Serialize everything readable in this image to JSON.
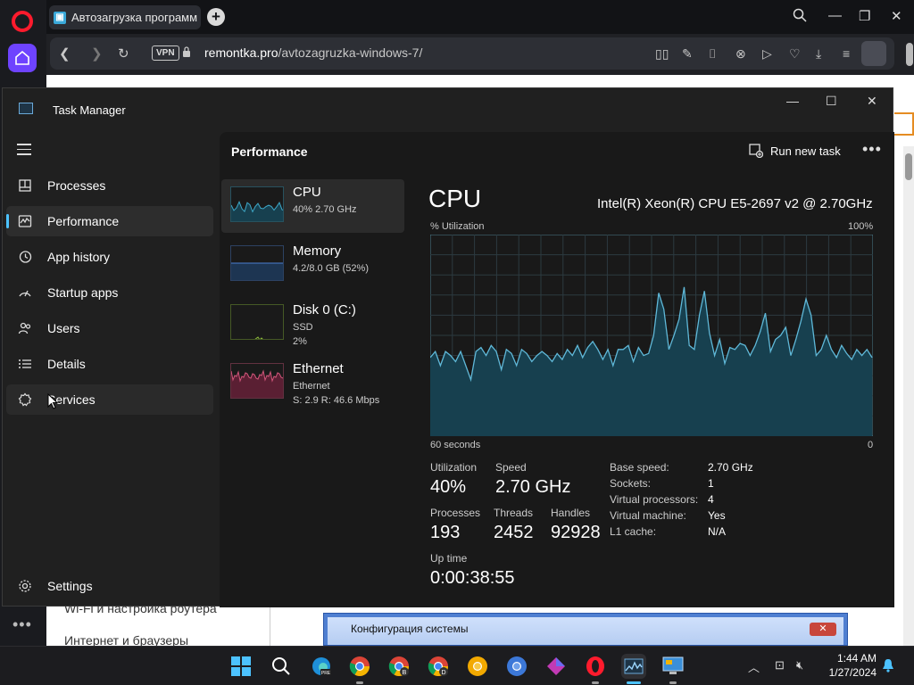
{
  "browser": {
    "tab_title": "Автозагрузка программ в",
    "tab_favicon": "monitor-icon",
    "vpn_label": "VPN",
    "url_domain": "remontka.pro",
    "url_path": "/avtozagruzka-windows-7/"
  },
  "webpage": {
    "menu_item_1": "Wi-Fi и настройка роутера",
    "menu_item_2": "Интернет и браузеры",
    "dialog_title": "Конфигурация системы"
  },
  "taskmanager": {
    "title": "Task Manager",
    "nav": [
      {
        "label": "Processes",
        "icon": "processes-icon"
      },
      {
        "label": "Performance",
        "icon": "performance-icon"
      },
      {
        "label": "App history",
        "icon": "history-icon"
      },
      {
        "label": "Startup apps",
        "icon": "startup-icon"
      },
      {
        "label": "Users",
        "icon": "users-icon"
      },
      {
        "label": "Details",
        "icon": "details-icon"
      },
      {
        "label": "Services",
        "icon": "services-icon"
      }
    ],
    "settings_label": "Settings",
    "active_nav": "Performance",
    "performance": {
      "heading": "Performance",
      "run_new_task": "Run new task",
      "resources": [
        {
          "name": "CPU",
          "sub1": "40%  2.70 GHz",
          "sub2": "",
          "color": "#3ea8c8"
        },
        {
          "name": "Memory",
          "sub1": "4.2/8.0 GB (52%)",
          "sub2": "",
          "color": "#4a7fd0"
        },
        {
          "name": "Disk 0 (C:)",
          "sub1": "SSD",
          "sub2": "2%",
          "color": "#8ab83a"
        },
        {
          "name": "Ethernet",
          "sub1": "Ethernet",
          "sub2": "S: 2.9  R: 46.6 Mbps",
          "color": "#d0567a"
        }
      ],
      "cpu": {
        "title": "CPU",
        "model": "Intel(R) Xeon(R) CPU E5-2697 v2 @ 2.70GHz",
        "y_label": "% Utilization",
        "y_max_label": "100%",
        "x_left_label": "60 seconds",
        "x_right_label": "0",
        "utilization_label": "Utilization",
        "utilization": "40%",
        "speed_label": "Speed",
        "speed": "2.70 GHz",
        "processes_label": "Processes",
        "processes": "193",
        "threads_label": "Threads",
        "threads": "2452",
        "handles_label": "Handles",
        "handles": "92928",
        "uptime_label": "Up time",
        "uptime": "0:00:38:55",
        "specs": [
          {
            "label": "Base speed:",
            "value": "2.70 GHz"
          },
          {
            "label": "Sockets:",
            "value": "1"
          },
          {
            "label": "Virtual processors:",
            "value": "4"
          },
          {
            "label": "Virtual machine:",
            "value": "Yes"
          },
          {
            "label": "L1 cache:",
            "value": "N/A"
          }
        ]
      }
    }
  },
  "chart_data": {
    "type": "area",
    "y_label": "% Utilization",
    "ylim": [
      0,
      100
    ],
    "x_labels": [
      "60 seconds",
      "0"
    ],
    "values": [
      39,
      42,
      35,
      42,
      40,
      37,
      42,
      35,
      28,
      42,
      44,
      40,
      45,
      42,
      33,
      43,
      41,
      35,
      43,
      41,
      37,
      40,
      42,
      40,
      37,
      41,
      38,
      43,
      40,
      45,
      39,
      44,
      47,
      43,
      38,
      43,
      35,
      43,
      43,
      45,
      37,
      44,
      40,
      41,
      50,
      71,
      63,
      43,
      50,
      58,
      74,
      45,
      43,
      60,
      72,
      51,
      40,
      48,
      36,
      44,
      43,
      46,
      45,
      40,
      45,
      52,
      61,
      42,
      48,
      50,
      54,
      40,
      48,
      57,
      68,
      60,
      40,
      43,
      50,
      43,
      39,
      45,
      41,
      38,
      43,
      40,
      43,
      39
    ],
    "line_color": "#5fb8d8",
    "fill_color": "#17404f",
    "grid": true
  },
  "taskbar": {
    "apps": [
      "start-icon",
      "search-icon",
      "edge-beta-icon",
      "chrome-icon",
      "chrome-beta-icon",
      "chrome-dev-icon",
      "chrome-canary-icon",
      "chromium-icon",
      "feather-app-icon",
      "opera-icon",
      "task-manager-icon",
      "remote-desktop-icon"
    ],
    "time": "1:44 AM",
    "date": "1/27/2024"
  }
}
